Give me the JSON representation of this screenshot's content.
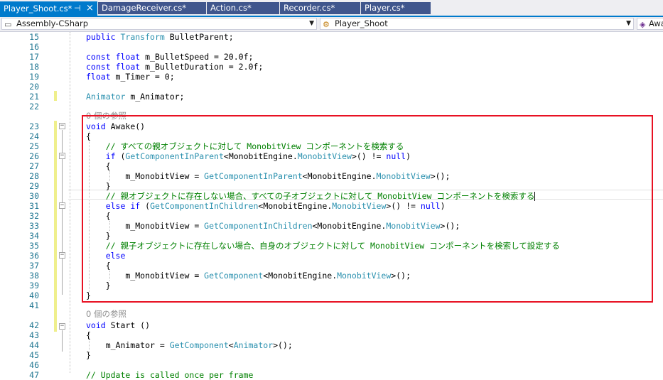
{
  "tabs": [
    {
      "label": "Player_Shoot.cs*",
      "active": true,
      "pin": "⊣",
      "close": "×"
    },
    {
      "label": "DamageReceiver.cs*",
      "active": false
    },
    {
      "label": "Action.cs*",
      "active": false
    },
    {
      "label": "Recorder.cs*",
      "active": false
    },
    {
      "label": "Player.cs*",
      "active": false
    }
  ],
  "navbar": {
    "project": "Assembly-CSharp",
    "class": "Player_Shoot",
    "member": "Awa"
  },
  "ref_label": "0 個の参照",
  "lines": [
    {
      "n": "15",
      "code": "public Transform BulletParent;"
    },
    {
      "n": "16",
      "code": ""
    },
    {
      "n": "17",
      "code": "const float m_BulletSpeed = 20.0f;"
    },
    {
      "n": "18",
      "code": "const float m_BulletDuration = 2.0f;"
    },
    {
      "n": "19",
      "code": "float m_Timer = 0;"
    },
    {
      "n": "20",
      "code": ""
    },
    {
      "n": "21",
      "code": "Animator m_Animator;"
    },
    {
      "n": "22",
      "code": ""
    },
    {
      "n": "23",
      "code": "void Awake()"
    },
    {
      "n": "24",
      "code": "{"
    },
    {
      "n": "25",
      "code": "    // すべての親オブジェクトに対して MonobitView コンポーネントを検索する"
    },
    {
      "n": "26",
      "code": "    if (GetComponentInParent<MonobitEngine.MonobitView>() != null)"
    },
    {
      "n": "27",
      "code": "    {"
    },
    {
      "n": "28",
      "code": "        m_MonobitView = GetComponentInParent<MonobitEngine.MonobitView>();"
    },
    {
      "n": "29",
      "code": "    }"
    },
    {
      "n": "30",
      "code": "    // 親オブジェクトに存在しない場合、すべての子オブジェクトに対して MonobitView コンポーネントを検索する"
    },
    {
      "n": "31",
      "code": "    else if (GetComponentInChildren<MonobitEngine.MonobitView>() != null)"
    },
    {
      "n": "32",
      "code": "    {"
    },
    {
      "n": "33",
      "code": "        m_MonobitView = GetComponentInChildren<MonobitEngine.MonobitView>();"
    },
    {
      "n": "34",
      "code": "    }"
    },
    {
      "n": "35",
      "code": "    // 親子オブジェクトに存在しない場合、自身のオブジェクトに対して MonobitView コンポーネントを検索して設定する"
    },
    {
      "n": "36",
      "code": "    else"
    },
    {
      "n": "37",
      "code": "    {"
    },
    {
      "n": "38",
      "code": "        m_MonobitView = GetComponent<MonobitEngine.MonobitView>();"
    },
    {
      "n": "39",
      "code": "    }"
    },
    {
      "n": "40",
      "code": "}"
    },
    {
      "n": "41",
      "code": ""
    },
    {
      "n": "42",
      "code": "void Start ()"
    },
    {
      "n": "43",
      "code": "{"
    },
    {
      "n": "44",
      "code": "    m_Animator = GetComponent<Animator>();"
    },
    {
      "n": "45",
      "code": "}"
    },
    {
      "n": "46",
      "code": ""
    },
    {
      "n": "47",
      "code": "// Update is called once per frame"
    }
  ],
  "colors": {
    "keyword": "#0000ff",
    "type": "#2b91af",
    "comment": "#008000",
    "line_number": "#237893",
    "highlight_box": "#e81123",
    "active_tab": "#007acc"
  }
}
